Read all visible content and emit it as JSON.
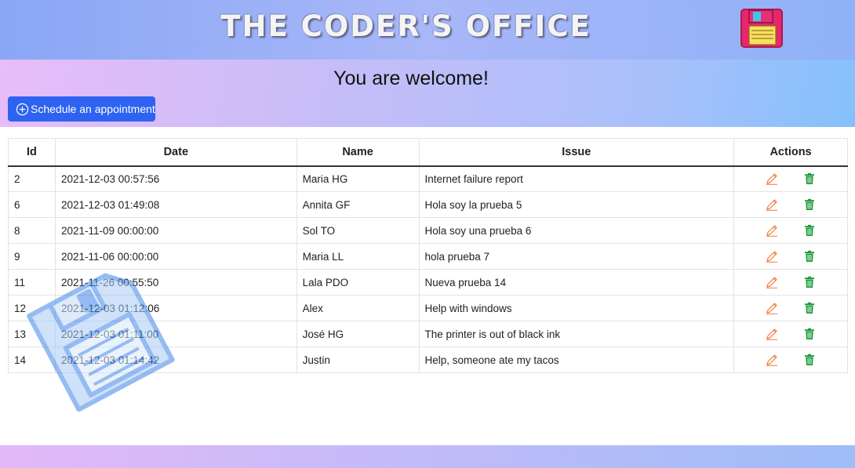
{
  "header": {
    "title": "THE CODER'S OFFICE",
    "logo_icon": "floppy-disk-icon"
  },
  "hero": {
    "welcome": "You are welcome!",
    "schedule_button": "Schedule an appointment",
    "schedule_icon": "plus-circle-icon"
  },
  "table": {
    "headers": {
      "id": "Id",
      "date": "Date",
      "name": "Name",
      "issue": "Issue",
      "actions": "Actions"
    },
    "rows": [
      {
        "id": "2",
        "date": "2021-12-03 00:57:56",
        "name": "Maria HG",
        "issue": "Internet failure report"
      },
      {
        "id": "6",
        "date": "2021-12-03 01:49:08",
        "name": "Annita GF",
        "issue": "Hola soy la prueba 5"
      },
      {
        "id": "8",
        "date": "2021-11-09 00:00:00",
        "name": "Sol TO",
        "issue": "Hola soy una prueba 6"
      },
      {
        "id": "9",
        "date": "2021-11-06 00:00:00",
        "name": "Maria LL",
        "issue": "hola prueba 7"
      },
      {
        "id": "11",
        "date": "2021-11-26 00:55:50",
        "name": "Lala PDO",
        "issue": "Nueva prueba 14"
      },
      {
        "id": "12",
        "date": "2021-12-03 01:12:06",
        "name": "Alex",
        "issue": "Help with windows"
      },
      {
        "id": "13",
        "date": "2021-12-03 01:11:00",
        "name": "José HG",
        "issue": "The printer is out of black ink"
      },
      {
        "id": "14",
        "date": "2021-12-03 01:14:42",
        "name": "Justin",
        "issue": "Help, someone ate my tacos"
      }
    ],
    "row_actions": {
      "edit_icon": "pencil-icon",
      "delete_icon": "trash-icon"
    }
  },
  "colors": {
    "button": "#2d63f0",
    "edit": "#f07a3c",
    "delete": "#1a9a3a",
    "watermark": "#5b9df0"
  }
}
